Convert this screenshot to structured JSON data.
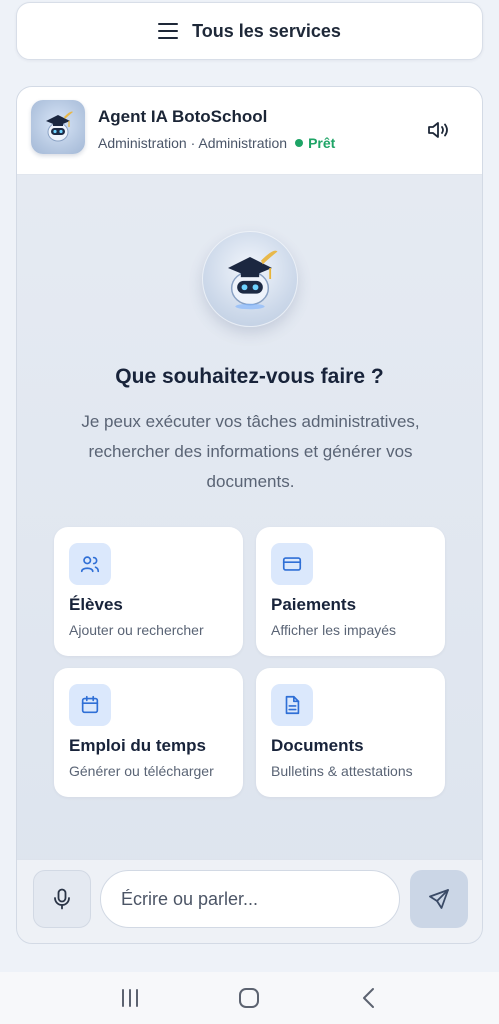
{
  "services_bar": {
    "label": "Tous les services",
    "icon": "menu-icon"
  },
  "agent": {
    "title": "Agent IA BotoSchool",
    "subtitle": "Administration · Administration",
    "status": "Prêt",
    "status_color": "#1ea466",
    "sound_icon": "speaker-icon"
  },
  "hero": {
    "title": "Que souhaitez-vous faire ?",
    "description": "Je peux exécuter vos tâches administratives, rechercher des informations et générer vos documents."
  },
  "actions": [
    {
      "icon": "users-icon",
      "title": "Élèves",
      "desc": "Ajouter ou rechercher"
    },
    {
      "icon": "credit-card-icon",
      "title": "Paiements",
      "desc": "Afficher les impayés"
    },
    {
      "icon": "calendar-icon",
      "title": "Emploi du temps",
      "desc": "Générer ou télécharger"
    },
    {
      "icon": "document-icon",
      "title": "Documents",
      "desc": "Bulletins & attestations"
    }
  ],
  "composer": {
    "placeholder": "Écrire ou parler...",
    "mic_icon": "microphone-icon",
    "send_icon": "send-icon"
  },
  "colors": {
    "accent": "#2f6fd6",
    "icon_bg": "#dbe8fc",
    "ready": "#1ea466"
  }
}
